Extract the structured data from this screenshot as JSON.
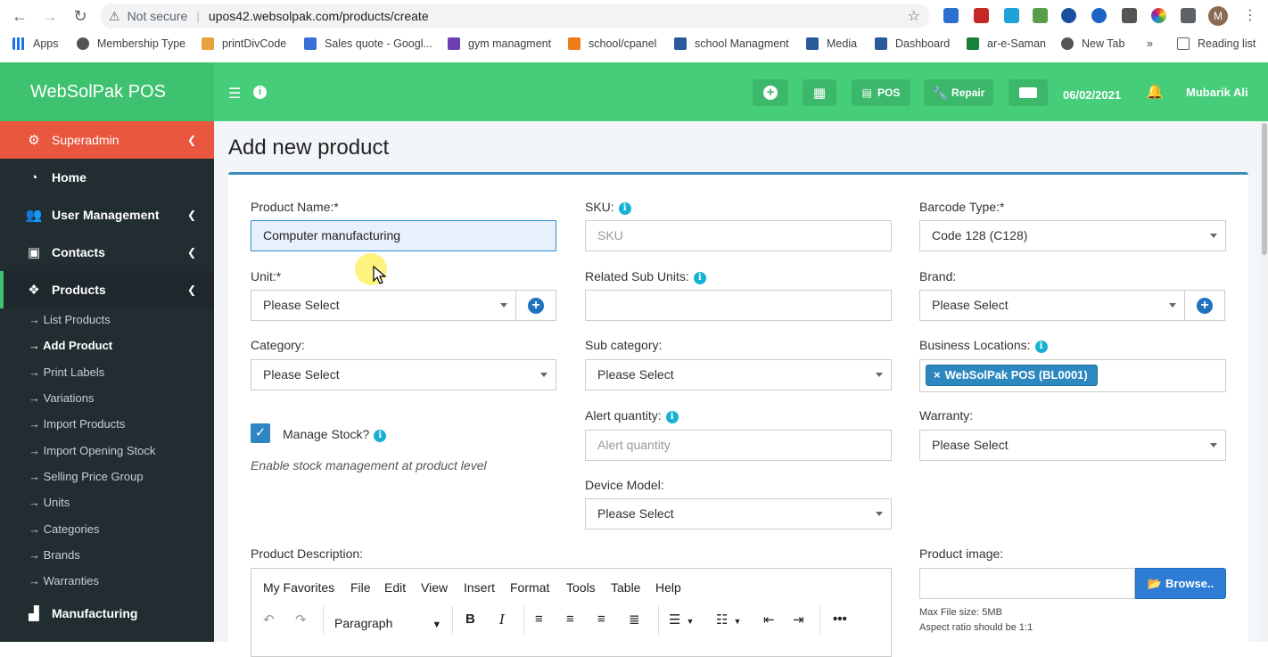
{
  "browser": {
    "security_label": "Not secure",
    "url": "upos42.websolpak.com/products/create",
    "profile_initial": "M"
  },
  "bookmarks": [
    "Apps",
    "Membership Type",
    "printDivCode",
    "Sales quote - Googl...",
    "gym managment",
    "school/cpanel",
    "school Managment",
    "Media",
    "Dashboard",
    "ar-e-Saman",
    "New Tab",
    "Reading list"
  ],
  "bookmarks_overflow": "»",
  "app": {
    "brand": "WebSolPak POS",
    "pos_label": "POS",
    "repair_label": "Repair",
    "date": "06/02/2021",
    "user": "Mubarik Ali"
  },
  "sidebar": {
    "items": [
      {
        "label": "Superadmin",
        "icon": "users-cog-icon"
      },
      {
        "label": "Home",
        "icon": "dashboard-icon"
      },
      {
        "label": "User Management",
        "icon": "users-icon"
      },
      {
        "label": "Contacts",
        "icon": "address-book-icon"
      },
      {
        "label": "Products",
        "icon": "cubes-icon"
      },
      {
        "label": "Manufacturing",
        "icon": "industry-icon"
      }
    ],
    "product_subitems": [
      "List Products",
      "Add Product",
      "Print Labels",
      "Variations",
      "Import Products",
      "Import Opening Stock",
      "Selling Price Group",
      "Units",
      "Categories",
      "Brands",
      "Warranties"
    ]
  },
  "page": {
    "title": "Add new product"
  },
  "form": {
    "product_name_label": "Product Name:*",
    "product_name_value": "Computer manufacturing",
    "sku_label": "SKU:",
    "sku_placeholder": "SKU",
    "barcode_label": "Barcode Type:*",
    "barcode_value": "Code 128 (C128)",
    "unit_label": "Unit:*",
    "unit_value": "Please Select",
    "sub_units_label": "Related Sub Units:",
    "brand_label": "Brand:",
    "brand_value": "Please Select",
    "category_label": "Category:",
    "category_value": "Please Select",
    "subcategory_label": "Sub category:",
    "subcategory_value": "Please Select",
    "locations_label": "Business Locations:",
    "location_tag": "WebSolPak POS (BL0001)",
    "manage_stock_label": "Manage Stock?",
    "manage_stock_checked": true,
    "manage_stock_note": "Enable stock management at product level",
    "alert_qty_label": "Alert quantity:",
    "alert_qty_placeholder": "Alert quantity",
    "warranty_label": "Warranty:",
    "warranty_value": "Please Select",
    "device_model_label": "Device Model:",
    "device_model_value": "Please Select",
    "description_label": "Product Description:",
    "image_label": "Product image:",
    "browse_label": "Browse..",
    "max_file_note": "Max File size: 5MB",
    "aspect_note": "Aspect ratio should be 1:1"
  },
  "editor": {
    "menus": [
      "My Favorites",
      "File",
      "Edit",
      "View",
      "Insert",
      "Format",
      "Tools",
      "Table",
      "Help"
    ],
    "block_format": "Paragraph"
  },
  "colors": {
    "header_green": "#45cd79",
    "brand_green": "#3fc26f",
    "sidebar_dark": "#222d32",
    "superadmin_red": "#e9573f",
    "primary_blue": "#2e7dd5"
  }
}
